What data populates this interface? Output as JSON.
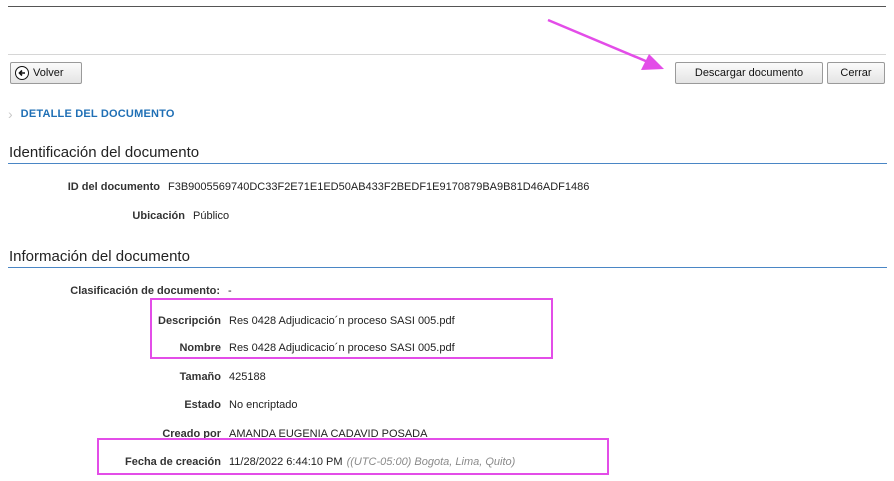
{
  "toolbar": {
    "back_label": "Volver",
    "download_label": "Descargar documento",
    "close_label": "Cerrar"
  },
  "section_title": "DETALLE DEL DOCUMENTO",
  "identification": {
    "title": "Identificación del documento",
    "id_label": "ID del documento",
    "id_value": "F3B9005569740DC33F2E71E1ED50AB433F2BEDF1E9170879BA9B81D46ADF1486",
    "location_label": "Ubicación",
    "location_value": "Público"
  },
  "information": {
    "title": "Información del documento",
    "classification_label": "Clasificación de documento:",
    "classification_value": "-",
    "description_label": "Descripción",
    "description_value": "Res 0428 Adjudicacio´n proceso SASI 005.pdf",
    "name_label": "Nombre",
    "name_value": "Res 0428 Adjudicacio´n proceso SASI 005.pdf",
    "size_label": "Tamaño",
    "size_value": "425188",
    "status_label": "Estado",
    "status_value": "No encriptado",
    "created_by_label": "Creado por",
    "created_by_value": "AMANDA EUGENIA CADAVID POSADA",
    "created_date_label": "Fecha de creación",
    "created_date_value": "11/28/2022 6:44:10 PM",
    "timezone": "((UTC-05:00) Bogota, Lima, Quito)"
  },
  "annotation_color": "#e34de8",
  "accent_color": "#1f6fb5"
}
